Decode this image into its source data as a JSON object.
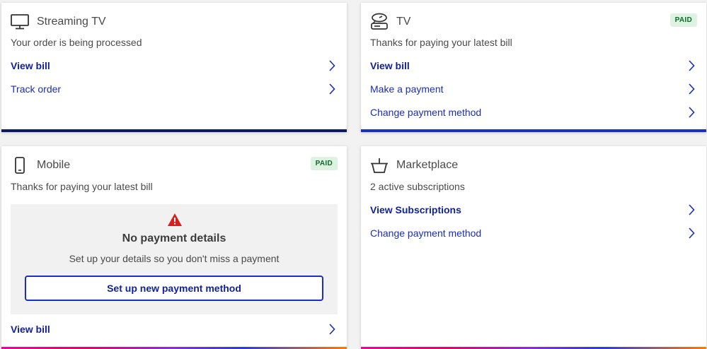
{
  "colors": {
    "link": "#1a2db8",
    "link_bold": "#101f9a",
    "paid_bg": "#ddf2e1",
    "paid_text": "#0b6b2a",
    "warning": "#d42020",
    "bar_dark": "#0c1a63",
    "bar_blue": "#1a2ecc"
  },
  "cards": [
    {
      "icon": "monitor-icon",
      "title": "Streaming TV",
      "subtitle": "Your order is being processed",
      "links": [
        "View bill",
        "Track order"
      ]
    },
    {
      "icon": "tv-box-icon",
      "title": "TV",
      "badge": "PAID",
      "subtitle": "Thanks for paying your latest bill",
      "links": [
        "View bill",
        "Make a payment",
        "Change payment method"
      ]
    },
    {
      "icon": "mobile-phone-icon",
      "title": "Mobile",
      "badge": "PAID",
      "subtitle": "Thanks for paying your latest bill",
      "alert": {
        "icon": "warning-icon",
        "title": "No payment details",
        "description": "Set up your details so you don't miss a payment",
        "button": "Set up new payment method"
      },
      "links": [
        "View bill"
      ]
    },
    {
      "icon": "basket-icon",
      "title": "Marketplace",
      "subtitle": "2 active subscriptions",
      "links": [
        "View Subscriptions",
        "Change payment method"
      ]
    }
  ]
}
